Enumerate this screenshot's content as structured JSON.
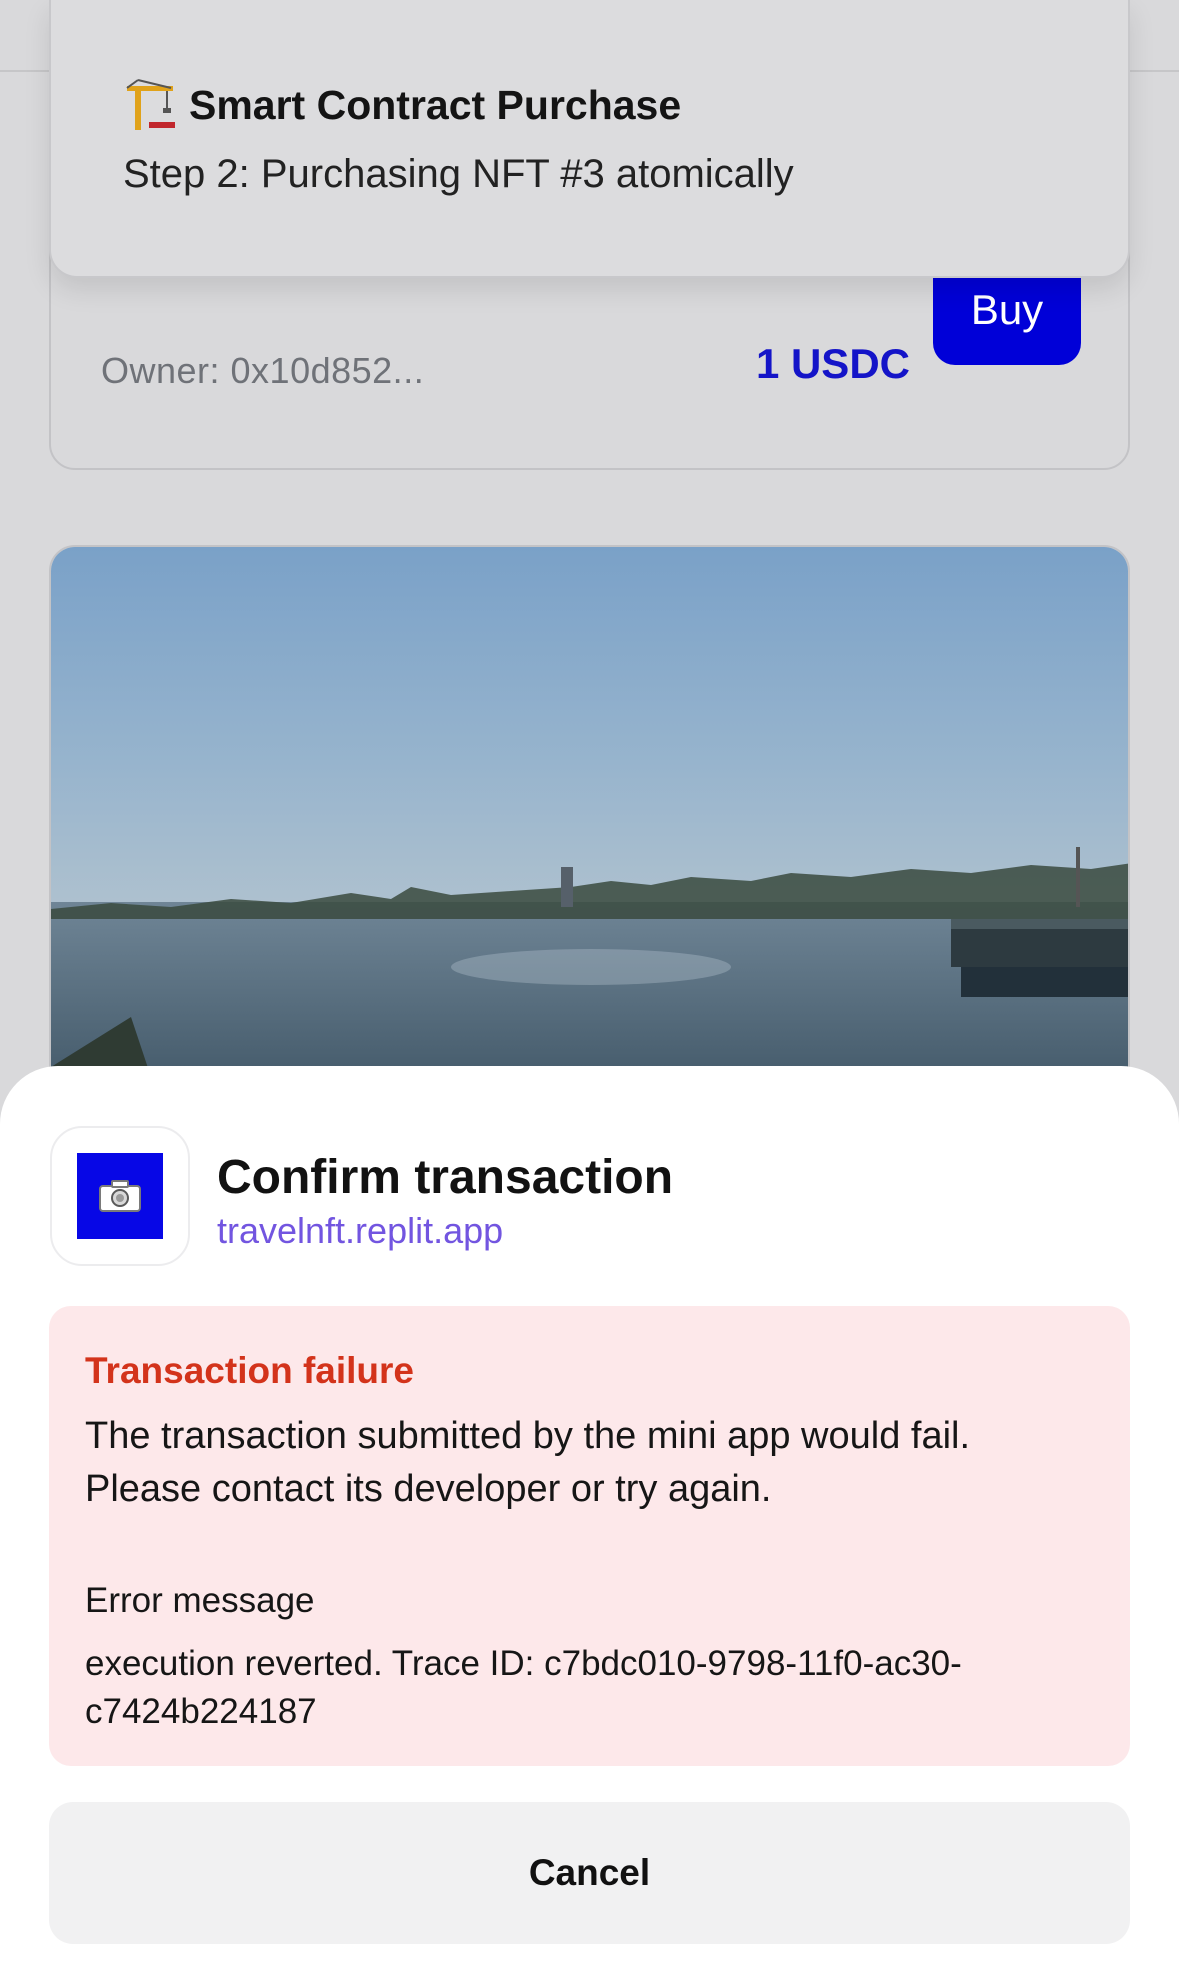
{
  "nft_card": {
    "owner_label": "Owner: 0x10d852...",
    "price": "1 USDC",
    "buy_label": "Buy"
  },
  "toast": {
    "icon": "construction-crane-emoji",
    "title": "Smart Contract Purchase",
    "subtitle": "Step 2: Purchasing NFT #3 atomically"
  },
  "photo": {
    "subject": "seaside-harbor-photo"
  },
  "sheet": {
    "app_icon": "camera-icon",
    "title": "Confirm transaction",
    "domain": "travelnft.replit.app",
    "error": {
      "heading": "Transaction failure",
      "body": "The transaction submitted by the mini app would fail. Please contact its developer or try again.",
      "message_label": "Error message",
      "message": "execution reverted. Trace ID: c7bdc010-9798-11f0-ac30-c7424b224187"
    },
    "cancel_label": "Cancel"
  },
  "colors": {
    "accent_blue": "#0000d8",
    "price_blue": "#1414c8",
    "error_red": "#d3331b",
    "error_bg": "#fde8ea",
    "domain_purple": "#7255e0"
  }
}
